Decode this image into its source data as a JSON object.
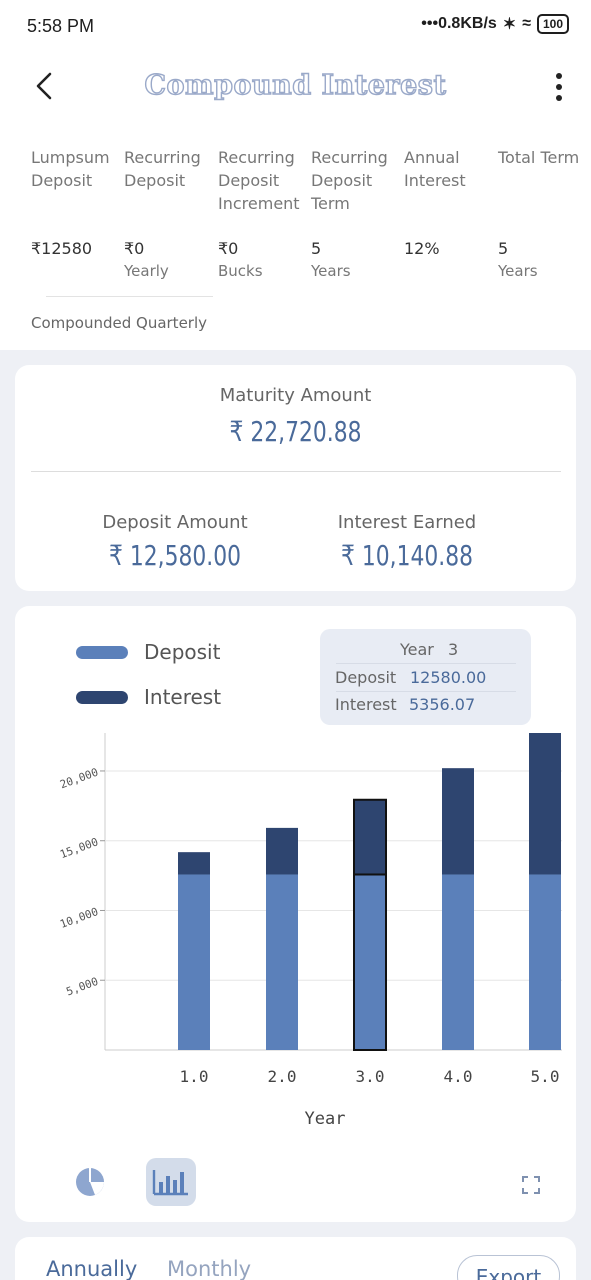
{
  "status_bar": {
    "time": "5:58 PM",
    "speed": "•••0.8KB/s",
    "battery": "100"
  },
  "app_bar": {
    "title": "Compound Interest"
  },
  "params": [
    {
      "label": "Lumpsum Deposit",
      "value": "₹12580",
      "unit": ""
    },
    {
      "label": "Recurring Deposit",
      "value": "₹0",
      "unit": "Yearly"
    },
    {
      "label": "Recurring Deposit Increment",
      "value": "₹0",
      "unit": "Bucks"
    },
    {
      "label": "Recurring Deposit Term",
      "value": "5",
      "unit": "Years"
    },
    {
      "label": "Annual Interest",
      "value": "12%",
      "unit": ""
    },
    {
      "label": "Total Term",
      "value": "5",
      "unit": "Years"
    }
  ],
  "compounding": "Compounded Quarterly",
  "summary": {
    "maturity_label": "Maturity Amount",
    "maturity_value": "₹ 22,720.88",
    "deposit_label": "Deposit Amount",
    "deposit_value": "₹ 12,580.00",
    "interest_label": "Interest Earned",
    "interest_value": "₹ 10,140.88"
  },
  "legend": {
    "deposit": "Deposit",
    "interest": "Interest"
  },
  "tooltip": {
    "year_label": "Year",
    "year_value": "3",
    "deposit_label": "Deposit",
    "deposit_value": "12580.00",
    "interest_label": "Interest",
    "interest_value": "5356.07"
  },
  "colors": {
    "deposit": "#5b80ba",
    "interest": "#2e4570"
  },
  "chart_data": {
    "type": "bar",
    "stacked": true,
    "x": [
      "1.0",
      "2.0",
      "3.0",
      "4.0",
      "5.0"
    ],
    "series": [
      {
        "name": "Deposit",
        "values": [
          12580,
          12580,
          12580,
          12580,
          12580
        ]
      },
      {
        "name": "Interest",
        "values": [
          1600,
          3340,
          5356.07,
          7620,
          10140.88
        ]
      }
    ],
    "xlabel": "Year",
    "yticks": [
      "5,000",
      "10,000",
      "15,000",
      "20,000"
    ],
    "ytick_values": [
      5000,
      10000,
      15000,
      20000
    ],
    "ylim": [
      0,
      22720.88
    ],
    "highlighted_index": 2,
    "grid": true
  },
  "bottom": {
    "tab_annually": "Annually",
    "tab_monthly": "Monthly",
    "export": "Export"
  }
}
